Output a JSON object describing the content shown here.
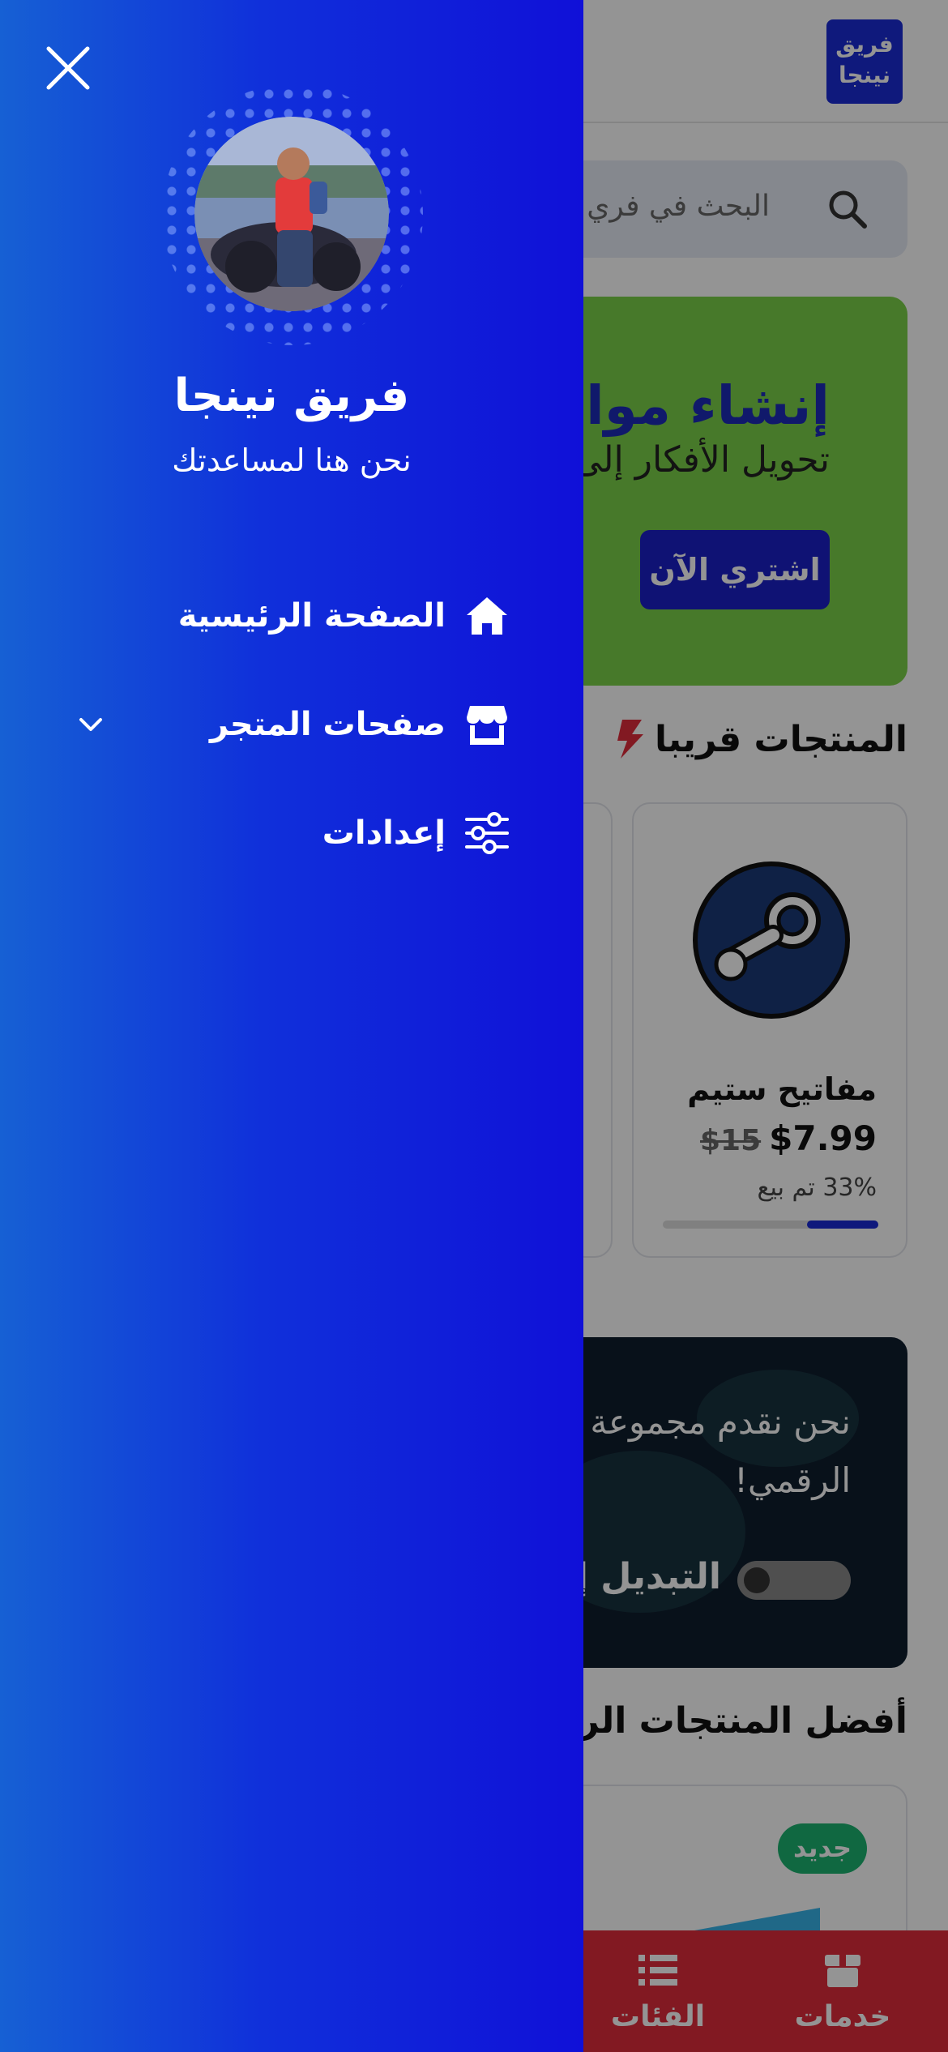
{
  "background": {
    "logo_text_line1": "فريق",
    "logo_text_line2": "نينجا",
    "search_placeholder": "البحث في فري",
    "banner": {
      "title": "إنشاء مواقع",
      "subtitle": "تحويل الأفكار إلى",
      "button": "اشتري الآن"
    },
    "section_title": "المنتجات قريبا",
    "product": {
      "name": "مفاتيح ستيم",
      "price": "$7.99",
      "old_price": "$15",
      "sold": "33% تم بيع",
      "sold_fraction": 0.33
    },
    "promo": {
      "line1": "نحن نقدم مجموعة",
      "line2": "الرقمي!",
      "toggle_label": "التبديل إلى"
    },
    "section_title2": "أفضل المنتجات الرقمية",
    "badge": "جديد",
    "bottom_nav": {
      "services": "خدمات",
      "categories": "الفئات"
    }
  },
  "drawer": {
    "name": "فريق نينجا",
    "subtitle": "نحن هنا لمساعدتك",
    "menu": [
      {
        "label": "الصفحة الرئيسية",
        "icon": "home-icon"
      },
      {
        "label": "صفحات المتجر",
        "icon": "store-icon",
        "expandable": true
      },
      {
        "label": "إعدادات",
        "icon": "sliders-icon"
      }
    ]
  },
  "colors": {
    "drawer_gradient_left": "#1660d4",
    "drawer_gradient_right": "#1010d8",
    "brand_blue": "#1a2bd6",
    "banner_green": "#7bd149",
    "nav_red": "#e02b3c"
  }
}
